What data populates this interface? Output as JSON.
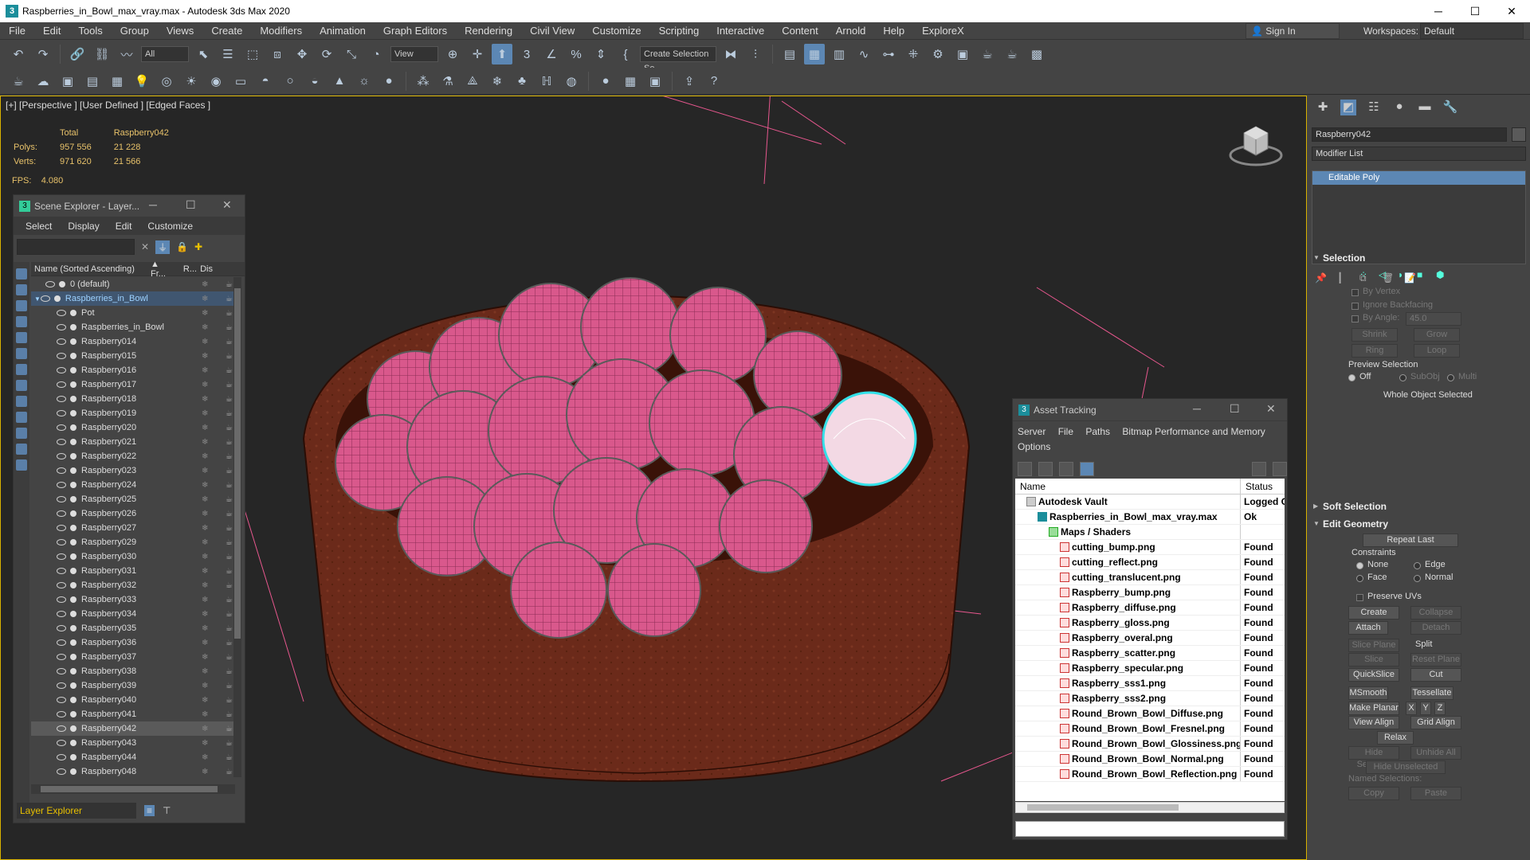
{
  "window": {
    "title": "Raspberries_in_Bowl_max_vray.max - Autodesk 3ds Max 2020",
    "min": "─",
    "max": "☐",
    "close": "✕"
  },
  "menu": [
    "File",
    "Edit",
    "Tools",
    "Group",
    "Views",
    "Create",
    "Modifiers",
    "Animation",
    "Graph Editors",
    "Rendering",
    "Civil View",
    "Customize",
    "Scripting",
    "Interactive",
    "Content",
    "Arnold",
    "Help",
    "ExploreX"
  ],
  "signin": "Sign In",
  "workspace": {
    "label": "Workspaces:",
    "value": "Default"
  },
  "toolbar": {
    "filter": "All",
    "refcoord": "View",
    "selset": "Create Selection Se"
  },
  "viewport": {
    "label": "[+] [Perspective ] [User Defined ] [Edged Faces ]",
    "stats": {
      "total_label": "Total",
      "object_label": "Raspberry042",
      "polys_label": "Polys:",
      "polys_total": "957 556",
      "polys_obj": "21 228",
      "verts_label": "Verts:",
      "verts_total": "971 620",
      "verts_obj": "21 566",
      "fps_label": "FPS:",
      "fps_value": "4.080"
    }
  },
  "scene_explorer": {
    "title": "Scene Explorer - Layer...",
    "menu": [
      "Select",
      "Display",
      "Edit",
      "Customize"
    ],
    "col_name": "Name (Sorted Ascending)",
    "col_fr": "▲ Fr...",
    "col_r": "R...",
    "col_dis": "Dis",
    "rows": [
      {
        "name": "0 (default)",
        "indent": 1
      },
      {
        "name": "Raspberries_in_Bowl",
        "indent": 0,
        "hl": true
      },
      {
        "name": "Pot",
        "indent": 2
      },
      {
        "name": "Raspberries_in_Bowl",
        "indent": 2
      },
      {
        "name": "Raspberry014",
        "indent": 2
      },
      {
        "name": "Raspberry015",
        "indent": 2
      },
      {
        "name": "Raspberry016",
        "indent": 2
      },
      {
        "name": "Raspberry017",
        "indent": 2
      },
      {
        "name": "Raspberry018",
        "indent": 2
      },
      {
        "name": "Raspberry019",
        "indent": 2
      },
      {
        "name": "Raspberry020",
        "indent": 2
      },
      {
        "name": "Raspberry021",
        "indent": 2
      },
      {
        "name": "Raspberry022",
        "indent": 2
      },
      {
        "name": "Raspberry023",
        "indent": 2
      },
      {
        "name": "Raspberry024",
        "indent": 2
      },
      {
        "name": "Raspberry025",
        "indent": 2
      },
      {
        "name": "Raspberry026",
        "indent": 2
      },
      {
        "name": "Raspberry027",
        "indent": 2
      },
      {
        "name": "Raspberry029",
        "indent": 2
      },
      {
        "name": "Raspberry030",
        "indent": 2
      },
      {
        "name": "Raspberry031",
        "indent": 2
      },
      {
        "name": "Raspberry032",
        "indent": 2
      },
      {
        "name": "Raspberry033",
        "indent": 2
      },
      {
        "name": "Raspberry034",
        "indent": 2
      },
      {
        "name": "Raspberry035",
        "indent": 2
      },
      {
        "name": "Raspberry036",
        "indent": 2
      },
      {
        "name": "Raspberry037",
        "indent": 2
      },
      {
        "name": "Raspberry038",
        "indent": 2
      },
      {
        "name": "Raspberry039",
        "indent": 2
      },
      {
        "name": "Raspberry040",
        "indent": 2
      },
      {
        "name": "Raspberry041",
        "indent": 2
      },
      {
        "name": "Raspberry042",
        "indent": 2,
        "selected": true
      },
      {
        "name": "Raspberry043",
        "indent": 2
      },
      {
        "name": "Raspberry044",
        "indent": 2
      },
      {
        "name": "Raspberry048",
        "indent": 2
      }
    ],
    "layer_explorer": "Layer Explorer"
  },
  "asset_tracking": {
    "title": "Asset Tracking",
    "menu": [
      "Server",
      "File",
      "Paths",
      "Bitmap Performance and Memory",
      "Options"
    ],
    "col_name": "Name",
    "col_status": "Status",
    "rows": [
      {
        "name": "Autodesk Vault",
        "status": "Logged O",
        "indent": 1
      },
      {
        "name": "Raspberries_in_Bowl_max_vray.max",
        "status": "Ok",
        "indent": 2
      },
      {
        "name": "Maps / Shaders",
        "status": "",
        "indent": 3
      },
      {
        "name": "cutting_bump.png",
        "status": "Found",
        "indent": 4
      },
      {
        "name": "cutting_reflect.png",
        "status": "Found",
        "indent": 4
      },
      {
        "name": "cutting_translucent.png",
        "status": "Found",
        "indent": 4
      },
      {
        "name": "Raspberry_bump.png",
        "status": "Found",
        "indent": 4
      },
      {
        "name": "Raspberry_diffuse.png",
        "status": "Found",
        "indent": 4
      },
      {
        "name": "Raspberry_gloss.png",
        "status": "Found",
        "indent": 4
      },
      {
        "name": "Raspberry_overal.png",
        "status": "Found",
        "indent": 4
      },
      {
        "name": "Raspberry_scatter.png",
        "status": "Found",
        "indent": 4
      },
      {
        "name": "Raspberry_specular.png",
        "status": "Found",
        "indent": 4
      },
      {
        "name": "Raspberry_sss1.png",
        "status": "Found",
        "indent": 4
      },
      {
        "name": "Raspberry_sss2.png",
        "status": "Found",
        "indent": 4
      },
      {
        "name": "Round_Brown_Bowl_Diffuse.png",
        "status": "Found",
        "indent": 4
      },
      {
        "name": "Round_Brown_Bowl_Fresnel.png",
        "status": "Found",
        "indent": 4
      },
      {
        "name": "Round_Brown_Bowl_Glossiness.png",
        "status": "Found",
        "indent": 4
      },
      {
        "name": "Round_Brown_Bowl_Normal.png",
        "status": "Found",
        "indent": 4
      },
      {
        "name": "Round_Brown_Bowl_Reflection.png",
        "status": "Found",
        "indent": 4
      }
    ]
  },
  "command_panel": {
    "object_name": "Raspberry042",
    "modifier_list": "Modifier List",
    "stack_item": "Editable Poly",
    "selection": {
      "title": "Selection",
      "by_vertex": "By Vertex",
      "ignore_backfacing": "Ignore Backfacing",
      "by_angle": "By Angle:",
      "angle_value": "45.0",
      "shrink": "Shrink",
      "grow": "Grow",
      "ring": "Ring",
      "loop": "Loop",
      "preview": "Preview Selection",
      "off": "Off",
      "subobj": "SubObj",
      "multi": "Multi",
      "status": "Whole Object Selected"
    },
    "soft_selection": "Soft Selection",
    "edit_geometry": {
      "title": "Edit Geometry",
      "repeat_last": "Repeat Last",
      "constraints": "Constraints",
      "none": "None",
      "edge": "Edge",
      "face": "Face",
      "normal": "Normal",
      "preserve_uvs": "Preserve UVs",
      "create": "Create",
      "collapse": "Collapse",
      "attach": "Attach",
      "detach": "Detach",
      "slice_plane": "Slice Plane",
      "split": "Split",
      "slice": "Slice",
      "reset_plane": "Reset Plane",
      "quickslice": "QuickSlice",
      "cut": "Cut",
      "msmooth": "MSmooth",
      "tessellate": "Tessellate",
      "make_planar": "Make Planar",
      "x": "X",
      "y": "Y",
      "z": "Z",
      "view_align": "View Align",
      "grid_align": "Grid Align",
      "relax": "Relax",
      "hide_selected": "Hide Selected",
      "unhide_all": "Unhide All",
      "hide_unselected": "Hide Unselected",
      "named_selections": "Named Selections:",
      "copy": "Copy",
      "paste": "Paste"
    }
  },
  "colors": {
    "accent": "#5c87b4",
    "viewport_border": "#d9b200",
    "raspberry": "#d9588c",
    "bowl": "#6b2a1a",
    "stats": "#e8c26a"
  }
}
